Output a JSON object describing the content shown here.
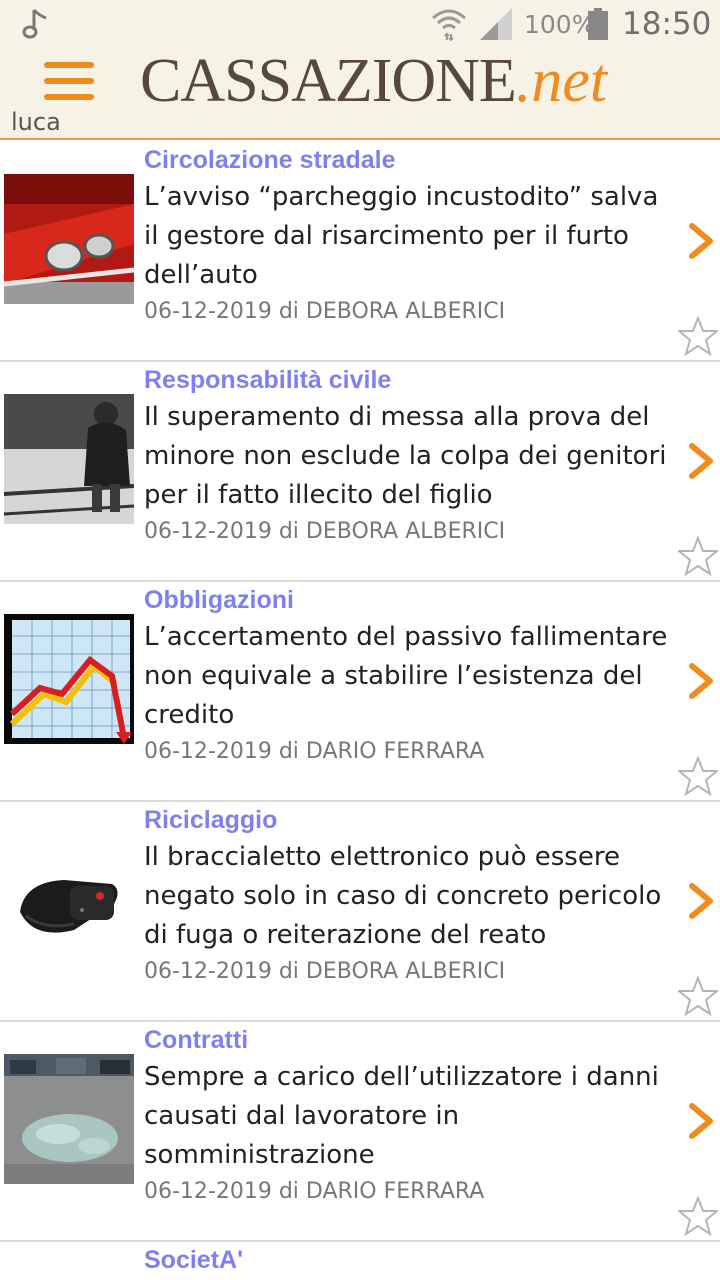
{
  "status_bar": {
    "battery_percent": "100%",
    "time": "18:50",
    "icons": [
      "music-note-icon",
      "wifi-icon",
      "signal-icon",
      "battery-icon"
    ]
  },
  "header": {
    "user": "luca",
    "logo_main": "CASSAZIONE",
    "logo_suffix": ".net",
    "menu_icon": "hamburger-menu-icon"
  },
  "colors": {
    "accent": "#f28b1e",
    "category": "#7f7ff0",
    "header_bg": "#f6f3e6",
    "logo_text": "#57483a"
  },
  "articles": [
    {
      "category": "Circolazione stradale",
      "title": "L’avviso “parcheggio incustodito” salva il gestore dal risarcimento per il furto dell’auto",
      "meta": "06-12-2019 di DEBORA ALBERICI",
      "thumbnail": "red-car-photo"
    },
    {
      "category": "Responsabilità civile",
      "title": "Il superamento di messa alla prova del minore non esclude la colpa dei genitori per il fatto illecito del figlio",
      "meta": "06-12-2019 di DEBORA ALBERICI",
      "thumbnail": "youth-sitting-photo"
    },
    {
      "category": "Obbligazioni",
      "title": "L’accertamento del passivo fallimentare non equivale a stabilire l’esistenza del credito",
      "meta": "06-12-2019 di DARIO FERRARA",
      "thumbnail": "falling-chart-image"
    },
    {
      "category": "Riciclaggio",
      "title": "Il braccialetto elettronico può essere negato solo in caso di concreto pericolo di fuga o reiterazione del reato",
      "meta": "06-12-2019 di DEBORA ALBERICI",
      "thumbnail": "electronic-bracelet-photo"
    },
    {
      "category": "Contratti",
      "title": "Sempre a carico dell’utilizzatore i danni causati dal lavoratore in somministrazione",
      "meta": "06-12-2019 di DARIO FERRARA",
      "thumbnail": "broken-glass-road-photo"
    },
    {
      "category": "SocietA'"
    }
  ]
}
